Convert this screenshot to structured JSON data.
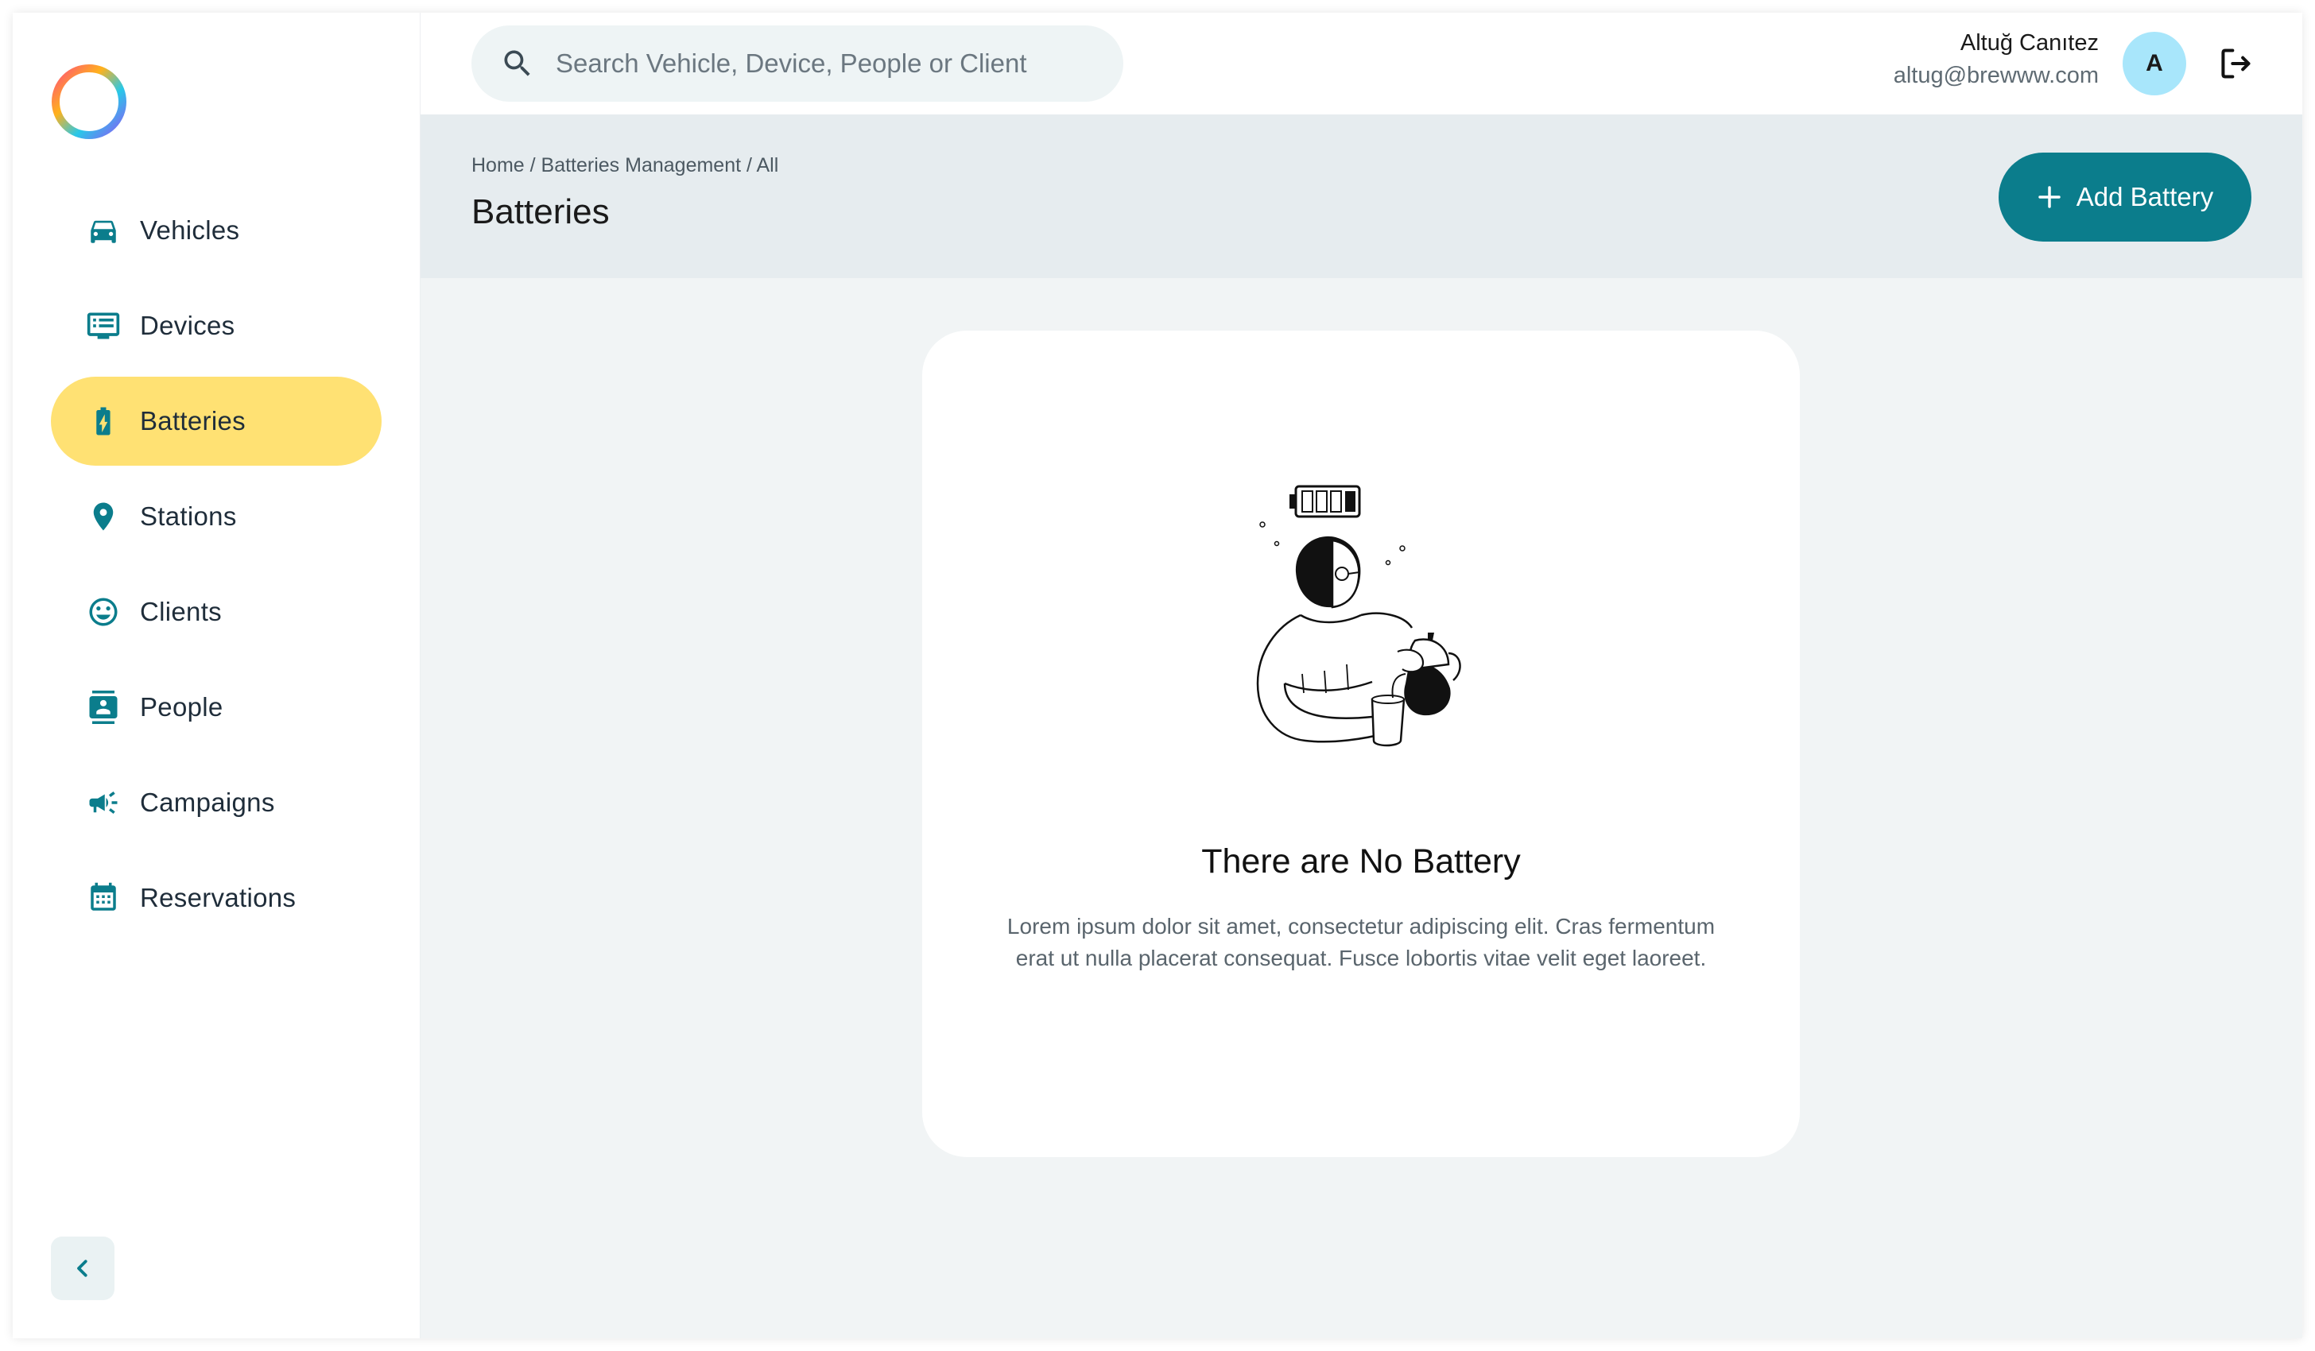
{
  "sidebar": {
    "items": [
      {
        "label": "Vehicles",
        "icon": "car-icon"
      },
      {
        "label": "Devices",
        "icon": "devices-icon"
      },
      {
        "label": "Batteries",
        "icon": "battery-icon",
        "active": true
      },
      {
        "label": "Stations",
        "icon": "location-pin-icon"
      },
      {
        "label": "Clients",
        "icon": "smiley-icon"
      },
      {
        "label": "People",
        "icon": "contact-card-icon"
      },
      {
        "label": "Campaigns",
        "icon": "megaphone-icon"
      },
      {
        "label": "Reservations",
        "icon": "calendar-icon"
      }
    ],
    "collapse_icon": "chevron-left-icon"
  },
  "search": {
    "placeholder": "Search Vehicle, Device, People or Client"
  },
  "user": {
    "name": "Altuğ Canıtez",
    "email": "altug@brewww.com",
    "avatar_letter": "A"
  },
  "breadcrumb": "Home / Batteries Management / All",
  "page_title": "Batteries",
  "add_button_label": "Add Battery",
  "empty_state": {
    "title": "There are No Battery",
    "description": "Lorem ipsum dolor sit amet, consectetur adipiscing elit. Cras fermentum erat ut nulla placerat consequat. Fusce lobortis vitae velit eget laoreet."
  },
  "colors": {
    "accent": "#0b7d8c",
    "active_nav": "#ffe173",
    "avatar": "#a8e6fb",
    "background": "#f1f4f5"
  }
}
